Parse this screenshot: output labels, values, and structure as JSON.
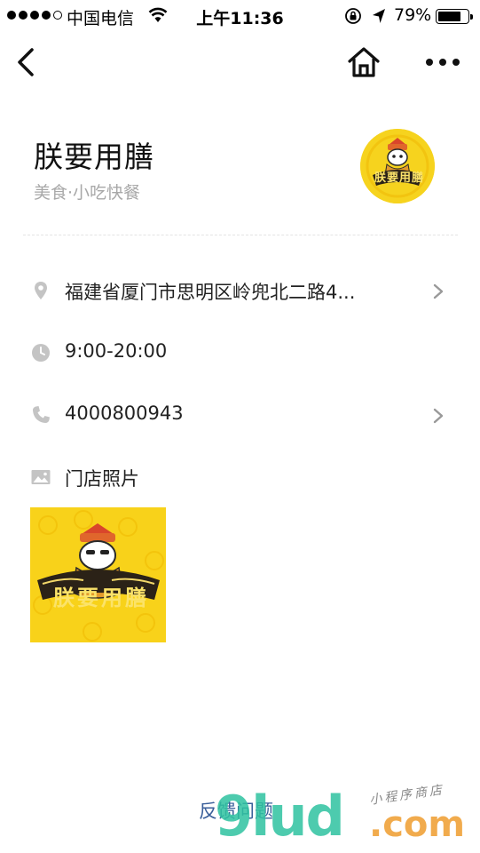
{
  "status_bar": {
    "carrier": "中国电信",
    "time": "上午11:36",
    "battery_percent": "79%",
    "battery_level": 0.79
  },
  "nav_bar": {
    "back_icon": "chevron-left-icon",
    "home_icon": "home-icon",
    "more_icon": "more-dots-icon"
  },
  "shop": {
    "name": "朕要用膳",
    "category": "美食·小吃快餐",
    "logo_text": "朕要用膳"
  },
  "info": {
    "address": "福建省厦门市思明区岭兜北二路4...",
    "hours": "9:00-20:00",
    "phone": "4000800943",
    "photos_label": "门店照片"
  },
  "footer": {
    "feedback_label": "反馈问题"
  },
  "watermark": {
    "main": "9lud",
    "sub": ".com",
    "tag": "小程序商店"
  },
  "colors": {
    "logo_yellow": "#f6d31e",
    "link_blue": "#3a5f9a",
    "icon_gray": "#c4c4c4",
    "secondary_text": "#a8a8a8"
  }
}
